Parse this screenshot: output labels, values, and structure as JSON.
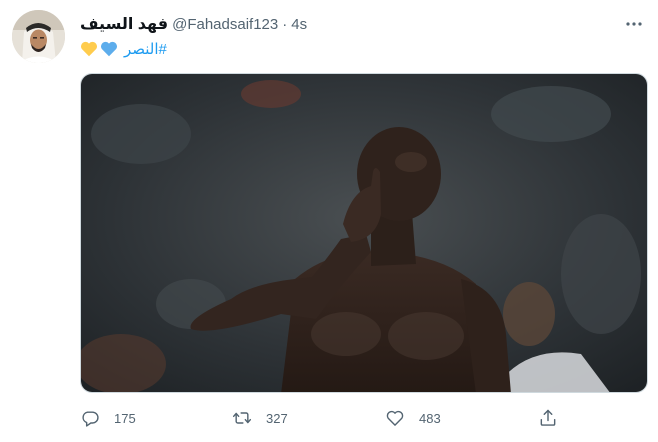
{
  "tweet": {
    "display_name": "فهد السيف",
    "handle": "@Fahadsaif123",
    "separator": "·",
    "time": "4s",
    "hashtag": "#النصر",
    "emojis": [
      "yellow-heart",
      "blue-heart"
    ],
    "image_alt": "Footballer celebrating with a finger to his lips",
    "colors": {
      "accent": "#1d9bf0",
      "secondary_text": "#536471",
      "yellow_heart": "#ffcc4d",
      "blue_heart": "#5dadec"
    }
  },
  "actions": {
    "reply_count": "175",
    "retweet_count": "327",
    "like_count": "483"
  }
}
